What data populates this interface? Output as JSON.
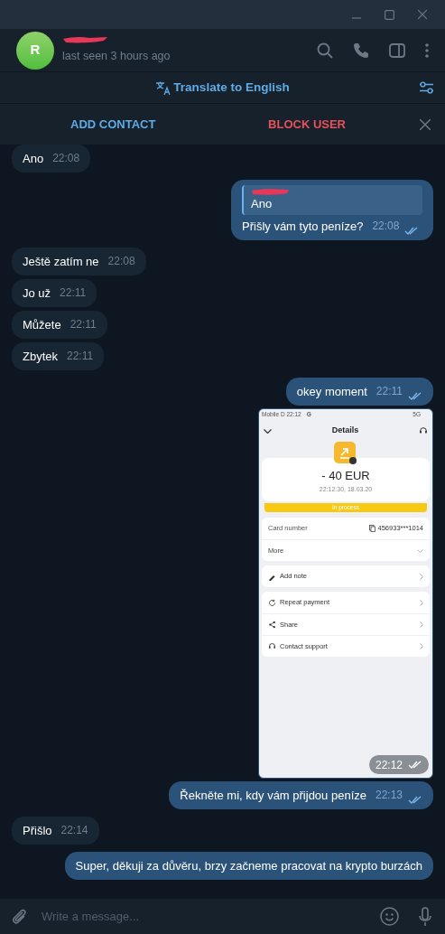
{
  "header": {
    "avatar_letter": "R",
    "status": "last seen 3 hours ago"
  },
  "translate_bar": {
    "label": "Translate to English"
  },
  "action_bar": {
    "add_contact": "ADD CONTACT",
    "block_user": "BLOCK USER"
  },
  "messages": [
    {
      "kind": "text",
      "outgoing": false,
      "text": "Ano",
      "time": "22:08"
    },
    {
      "kind": "reply",
      "outgoing": true,
      "quote": "Ano",
      "text": "Přišly vám tyto peníze?",
      "time": "22:08"
    },
    {
      "kind": "text",
      "outgoing": false,
      "text": "Ještě zatím ne",
      "time": "22:08"
    },
    {
      "kind": "text",
      "outgoing": false,
      "text": "Jo už",
      "time": "22:11"
    },
    {
      "kind": "text",
      "outgoing": false,
      "text": "Můžete",
      "time": "22:11"
    },
    {
      "kind": "text",
      "outgoing": false,
      "text": "Zbytek",
      "time": "22:11"
    },
    {
      "kind": "text",
      "outgoing": true,
      "text": "okey moment",
      "time": "22:11"
    },
    {
      "kind": "image",
      "outgoing": true,
      "time": "22:12",
      "screenshot": {
        "status_left": "Mobile D  22:12",
        "status_g": "G",
        "status_right": "5G",
        "title": "Details",
        "amount": "- 40 EUR",
        "date": "22:12:30, 18.03.20",
        "badge": "In process",
        "card_label": "Card number",
        "card_value": "456933***1014",
        "more": "More",
        "actions": [
          {
            "kind": "note",
            "label": "Add note"
          }
        ],
        "actions2": [
          {
            "kind": "repeat",
            "label": "Repeat payment"
          },
          {
            "kind": "share",
            "label": "Share"
          },
          {
            "kind": "support",
            "label": "Contact support"
          }
        ]
      }
    },
    {
      "kind": "text",
      "outgoing": true,
      "text": "Řekněte mi, kdy vám přijdou peníze",
      "time": "22:13"
    },
    {
      "kind": "text",
      "outgoing": false,
      "text": "Přišlo",
      "time": "22:14"
    },
    {
      "kind": "text",
      "outgoing": true,
      "text": "Super, děkuji za důvěru, brzy začneme pracovat na krypto burzách"
    }
  ],
  "composer": {
    "placeholder": "Write a message..."
  }
}
